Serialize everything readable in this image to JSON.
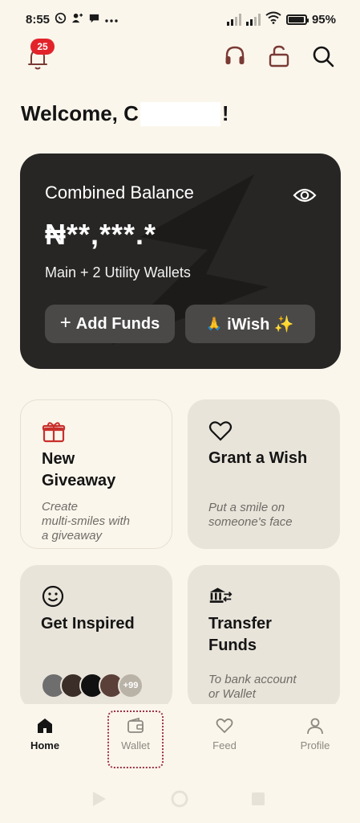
{
  "status_bar": {
    "time": "8:55",
    "notification_icons": [
      "whatsapp-icon",
      "person-sync-icon",
      "chat-bubble-icon",
      "more-dots-icon"
    ],
    "battery_percent": "95%",
    "battery_level": 0.95
  },
  "top_bar": {
    "notification_count": "25",
    "icons": [
      "bell-icon",
      "headset-icon",
      "unlock-icon",
      "search-icon"
    ]
  },
  "welcome": {
    "prefix": "Welcome, C",
    "suffix": "!"
  },
  "balance_card": {
    "title": "Combined Balance",
    "amount": "₦**,***.*",
    "subtitle": "Main + 2 Utility Wallets",
    "add_funds_label": "Add Funds",
    "iwish_label": "iWish ✨",
    "iwish_emoji": "🙏"
  },
  "tiles": {
    "new_giveaway": {
      "title_line1": "New",
      "title_line2": "Giveaway",
      "desc_line1": "Create",
      "desc_line2": "multi-smiles with",
      "desc_line3": "a giveaway"
    },
    "grant_wish": {
      "title": "Grant a Wish",
      "desc_line1": "Put a smile on",
      "desc_line2": "someone's face"
    },
    "get_inspired": {
      "title": "Get Inspired",
      "more_count": "+99"
    },
    "transfer_funds": {
      "title_line1": "Transfer",
      "title_line2": "Funds",
      "desc_line1": "To bank account",
      "desc_line2": "or Wallet"
    }
  },
  "bottom_nav": {
    "items": [
      {
        "label": "Home",
        "icon": "home-icon",
        "active": true
      },
      {
        "label": "Wallet",
        "icon": "wallet-icon",
        "active": false
      },
      {
        "label": "Feed",
        "icon": "heart-icon",
        "active": false
      },
      {
        "label": "Profile",
        "icon": "user-icon",
        "active": false
      }
    ]
  },
  "colors": {
    "background": "#fbf6ec",
    "card_dark": "#272625",
    "tile": "#e9e4da",
    "badge": "#e2232a",
    "gift_accent": "#c8302c"
  }
}
